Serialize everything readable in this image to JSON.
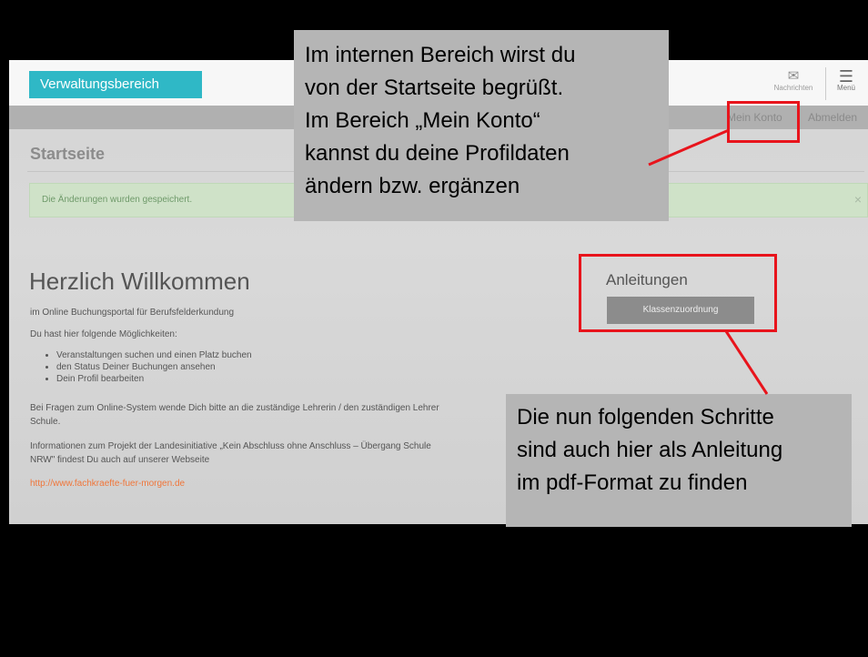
{
  "header": {
    "brand_label": "Verwaltungsbereich",
    "messages_label": "Nachrichten",
    "menu_label": "Menü",
    "envelope_glyph": "✉",
    "menu_glyph": "☰"
  },
  "nav": {
    "account_link": "Mein Konto",
    "logout_link": "Abmelden"
  },
  "main": {
    "page_title": "Startseite",
    "alert_text": "Die Änderungen wurden gespeichert.",
    "alert_close": "×",
    "welcome_heading": "Herzlich Willkommen",
    "subtitle": "im Online Buchungsportal für Berufsfelderkundung",
    "options_intro": "Du hast  hier folgende Möglichkeiten:",
    "options": [
      "Veranstaltungen suchen und einen Platz buchen",
      "den Status Deiner Buchungen ansehen",
      "Dein Profil bearbeiten"
    ],
    "questions_line1": "Bei Fragen zum Online-System wende Dich bitte an die zuständige Lehrerin / den zuständigen Lehrer",
    "questions_line2": "Schule.",
    "info_line1": "Informationen zum Projekt der Landesinitiative „Kein Abschluss ohne Anschluss – Übergang Schule",
    "info_line2": "NRW\" findest Du auch auf unserer Webseite",
    "website_link": "http://www.fachkraefte-fuer-morgen.de"
  },
  "guides": {
    "title": "Anleitungen",
    "button_label": "Klassenzuordnung"
  },
  "annotations": {
    "box1_lines": [
      "Im internen Bereich wirst du",
      "von der Startseite begrüßt.",
      "Im Bereich „Mein Konto“",
      "kannst du deine Profildaten",
      "ändern bzw. ergänzen"
    ],
    "box2_lines": [
      "Die nun folgenden Schritte",
      "sind auch hier als Anleitung",
      "im pdf-Format zu finden"
    ]
  },
  "colors": {
    "brand": "#2fb8c6",
    "highlight": "#e8141c",
    "link": "#f0763a"
  }
}
